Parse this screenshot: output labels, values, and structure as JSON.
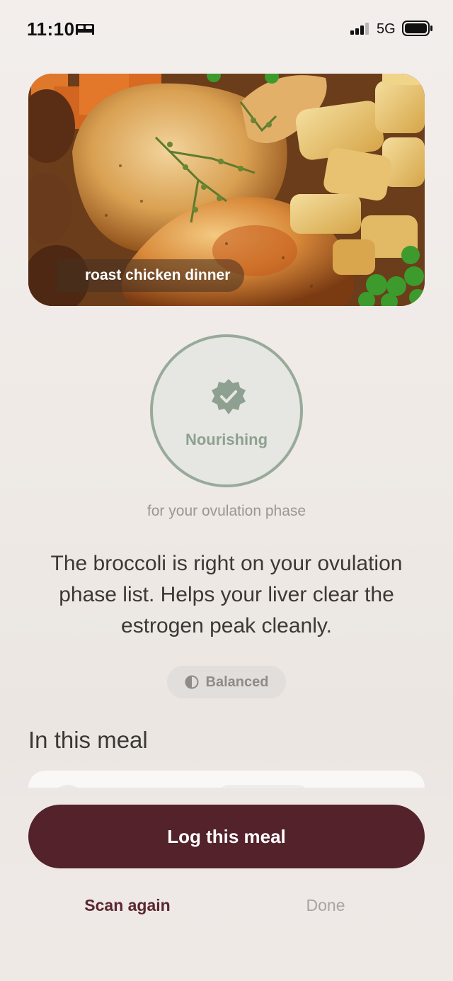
{
  "status_bar": {
    "time": "11:10",
    "sleep_icon": "bed-icon",
    "network": "5G",
    "signal_icon": "signal-bars-icon",
    "battery_icon": "battery-icon"
  },
  "meal": {
    "name": "roast chicken dinner"
  },
  "rating": {
    "icon": "verified-badge-check-icon",
    "label": "Nourishing",
    "caption": "for your ovulation phase",
    "ring_color": "#98aa9a"
  },
  "insight": "The broccoli is right on your ovulation phase list. Helps your liver clear the estrogen peak cleanly.",
  "balance": {
    "icon": "half-circle-icon",
    "label": "Balanced"
  },
  "ingredients": {
    "heading": "In this meal"
  },
  "actions": {
    "log_label": "Log this meal",
    "scan_again_label": "Scan again",
    "done_label": "Done"
  },
  "colors": {
    "primary_button": "#53222b",
    "accent_green": "#8ea090",
    "background": "#efeae6"
  }
}
